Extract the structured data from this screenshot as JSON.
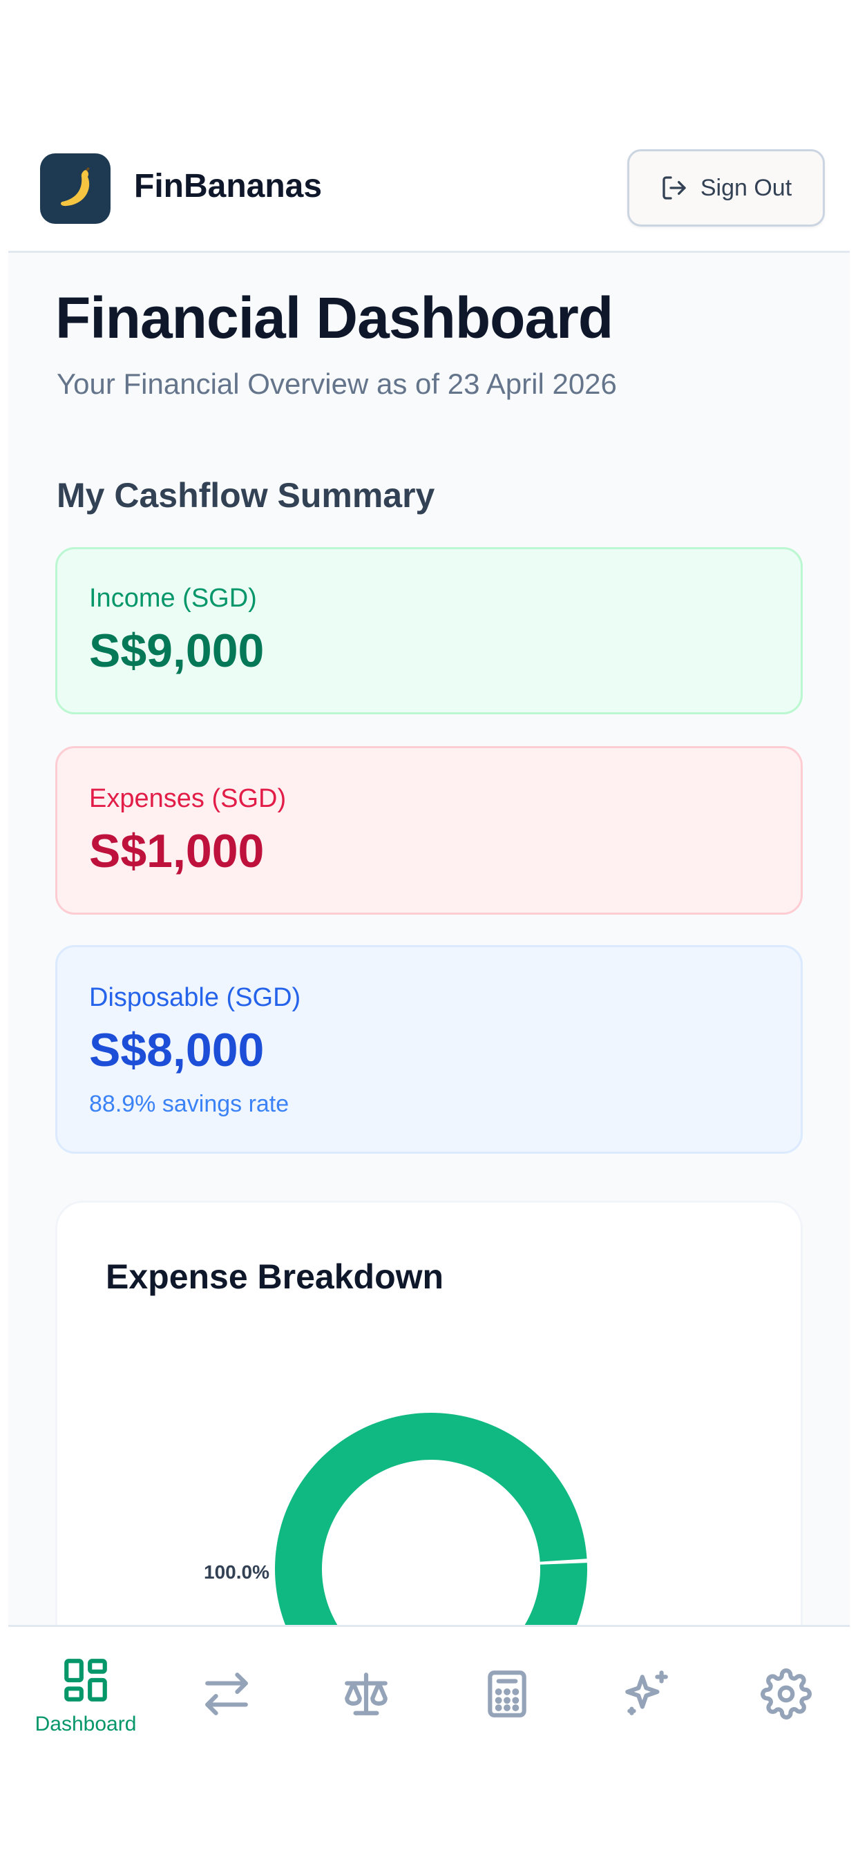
{
  "app": {
    "brand": "FinBananas",
    "sign_out_label": "Sign Out"
  },
  "page": {
    "title": "Financial Dashboard",
    "subtitle": "Your Financial Overview as of 23 April 2026"
  },
  "cashflow": {
    "section_title": "My Cashflow Summary",
    "income": {
      "label": "Income (SGD)",
      "value": "S$9,000"
    },
    "expenses": {
      "label": "Expenses (SGD)",
      "value": "S$1,000"
    },
    "disposable": {
      "label": "Disposable (SGD)",
      "value": "S$8,000",
      "note": "88.9% savings rate"
    }
  },
  "expense_breakdown": {
    "title": "Expense Breakdown"
  },
  "chart_data": {
    "type": "pie",
    "title": "Expense Breakdown",
    "style": "donut",
    "slices": [
      {
        "label": "100.0%",
        "value": 100.0,
        "color": "#10b981"
      }
    ]
  },
  "colors": {
    "accent": "#059669",
    "income": "#047857",
    "expenses": "#be123c",
    "disposable": "#1d4ed8",
    "nav_inactive": "#94a3b8"
  },
  "nav": {
    "items": [
      {
        "label": "Dashboard",
        "icon": "grid-icon",
        "active": true
      },
      {
        "label": "",
        "icon": "transfer-arrows-icon",
        "active": false
      },
      {
        "label": "",
        "icon": "scale-icon",
        "active": false
      },
      {
        "label": "",
        "icon": "calculator-icon",
        "active": false
      },
      {
        "label": "",
        "icon": "sparkles-icon",
        "active": false
      },
      {
        "label": "",
        "icon": "gear-icon",
        "active": false
      }
    ]
  }
}
